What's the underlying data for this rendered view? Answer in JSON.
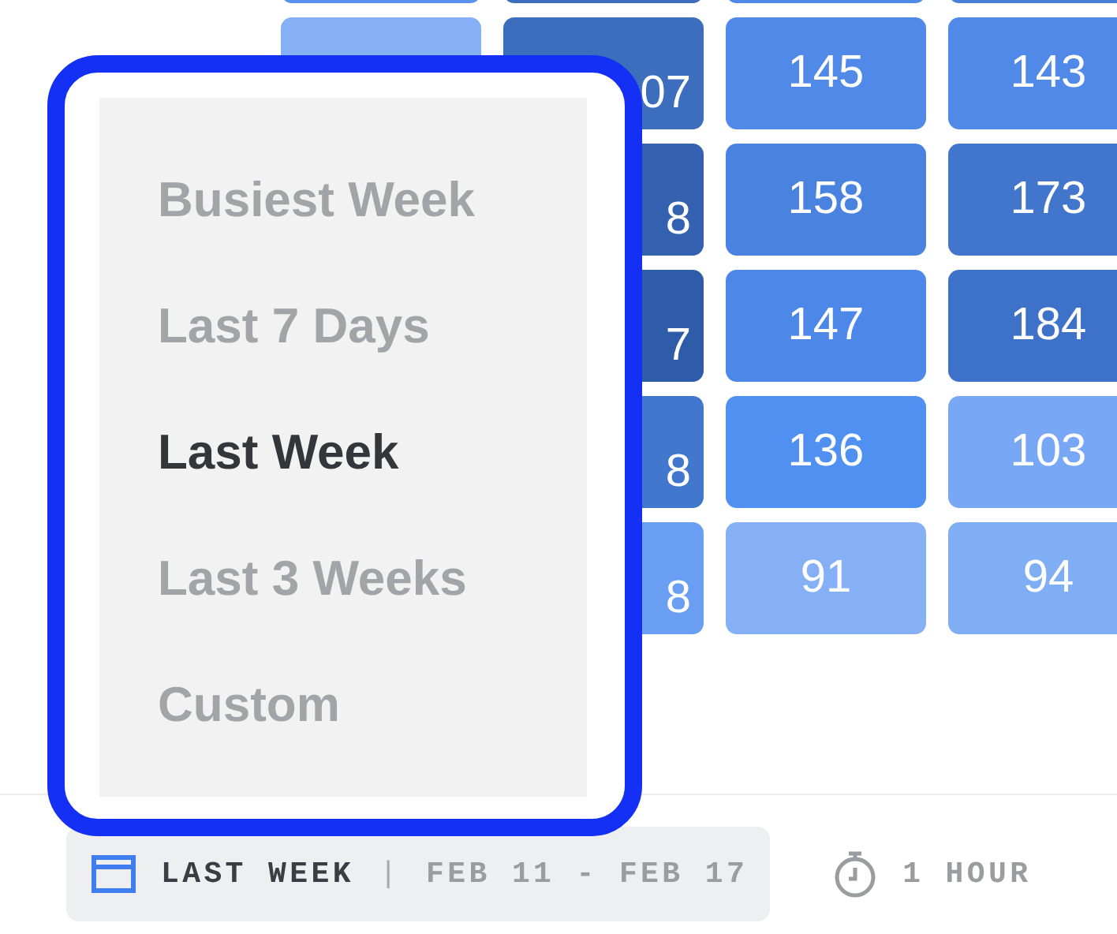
{
  "heatmap": {
    "rows": [
      {
        "cells": [
          {
            "color": "#5a90ee",
            "kind": "empty"
          },
          {
            "color": "#3d6dbd",
            "kind": "empty"
          },
          {
            "color": "#5089e8",
            "kind": "empty"
          },
          {
            "color": "#4a7fd8",
            "kind": "empty"
          }
        ]
      },
      {
        "cells": [
          {
            "color": "#86b0f5",
            "kind": "empty"
          },
          {
            "color": "#3d6dbd",
            "kind": "clipped",
            "text": "07"
          },
          {
            "color": "#5089e8",
            "kind": "full",
            "text": "145"
          },
          {
            "color": "#5089e8",
            "kind": "full",
            "text": "143"
          }
        ]
      },
      {
        "cells": [
          "",
          {
            "color": "#3461b0",
            "kind": "clipped",
            "text": "8"
          },
          {
            "color": "#4a82e0",
            "kind": "full",
            "text": "158"
          },
          {
            "color": "#4275cc",
            "kind": "full",
            "text": "173"
          }
        ]
      },
      {
        "cells": [
          "",
          {
            "color": "#2f5ca8",
            "kind": "clipped",
            "text": "7"
          },
          {
            "color": "#4d87e8",
            "kind": "full",
            "text": "147"
          },
          {
            "color": "#3e72c8",
            "kind": "full",
            "text": "184"
          }
        ]
      },
      {
        "cells": [
          "",
          {
            "color": "#4177cc",
            "kind": "clipped",
            "text": "8"
          },
          {
            "color": "#5090f0",
            "kind": "full",
            "text": "136"
          },
          {
            "color": "#78a8f5",
            "kind": "full",
            "text": "103"
          }
        ]
      },
      {
        "cells": [
          "",
          {
            "color": "#6a9ef2",
            "kind": "clipped",
            "text": "8"
          },
          {
            "color": "#85b0f5",
            "kind": "full",
            "text": "91"
          },
          {
            "color": "#80aef5",
            "kind": "full",
            "text": "94"
          }
        ]
      }
    ]
  },
  "range_menu": {
    "items": [
      {
        "label": "Busiest Week",
        "selected": false
      },
      {
        "label": "Last 7 Days",
        "selected": false
      },
      {
        "label": "Last Week",
        "selected": true
      },
      {
        "label": "Last 3 Weeks",
        "selected": false
      },
      {
        "label": "Custom",
        "selected": false
      }
    ]
  },
  "footer": {
    "range_button": {
      "label": "LAST WEEK",
      "separator": "|",
      "dates": "FEB 11 - FEB 17"
    },
    "interval": {
      "label": "1 HOUR"
    }
  }
}
